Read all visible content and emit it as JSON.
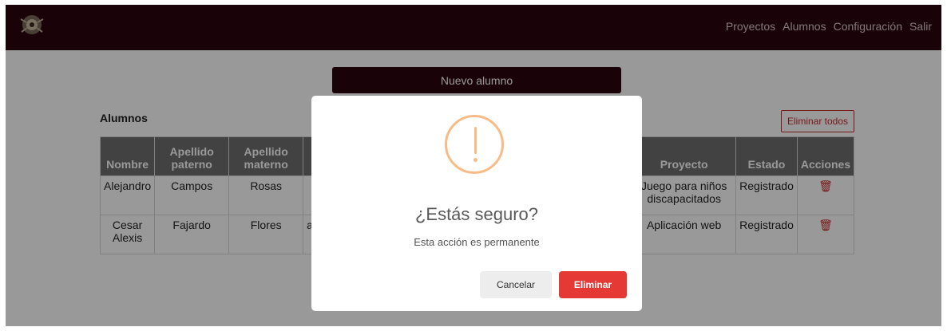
{
  "navbar": {
    "links": [
      "Proyectos",
      "Alumnos",
      "Configuración",
      "Salir"
    ],
    "background": "#2c0410"
  },
  "main": {
    "new_button": "Nuevo alumno",
    "section_title": "Alumnos",
    "delete_all": "Eliminar todos",
    "table": {
      "headers": [
        "Nombre",
        "Apellido paterno",
        "Apellido materno",
        "",
        "Proyecto",
        "Estado",
        "Acciones"
      ],
      "rows": [
        {
          "nombre": "Alejandro",
          "paterno": "Campos",
          "materno": "Rosas",
          "correo": "",
          "proyecto": "Juego para niños discapacitados",
          "estado": "Registrado",
          "accion": "trash-icon"
        },
        {
          "nombre": "Cesar Alexis",
          "paterno": "Fajardo",
          "materno": "Flores",
          "correo": "a",
          "proyecto": "Aplicación web",
          "estado": "Registrado",
          "accion": "trash-icon"
        }
      ]
    }
  },
  "modal": {
    "icon": "warning-icon",
    "title": "¿Estás seguro?",
    "text": "Esta acción es permanente",
    "cancel": "Cancelar",
    "confirm": "Eliminar",
    "warning_color": "#f8bb86",
    "confirm_color": "#e53935"
  }
}
